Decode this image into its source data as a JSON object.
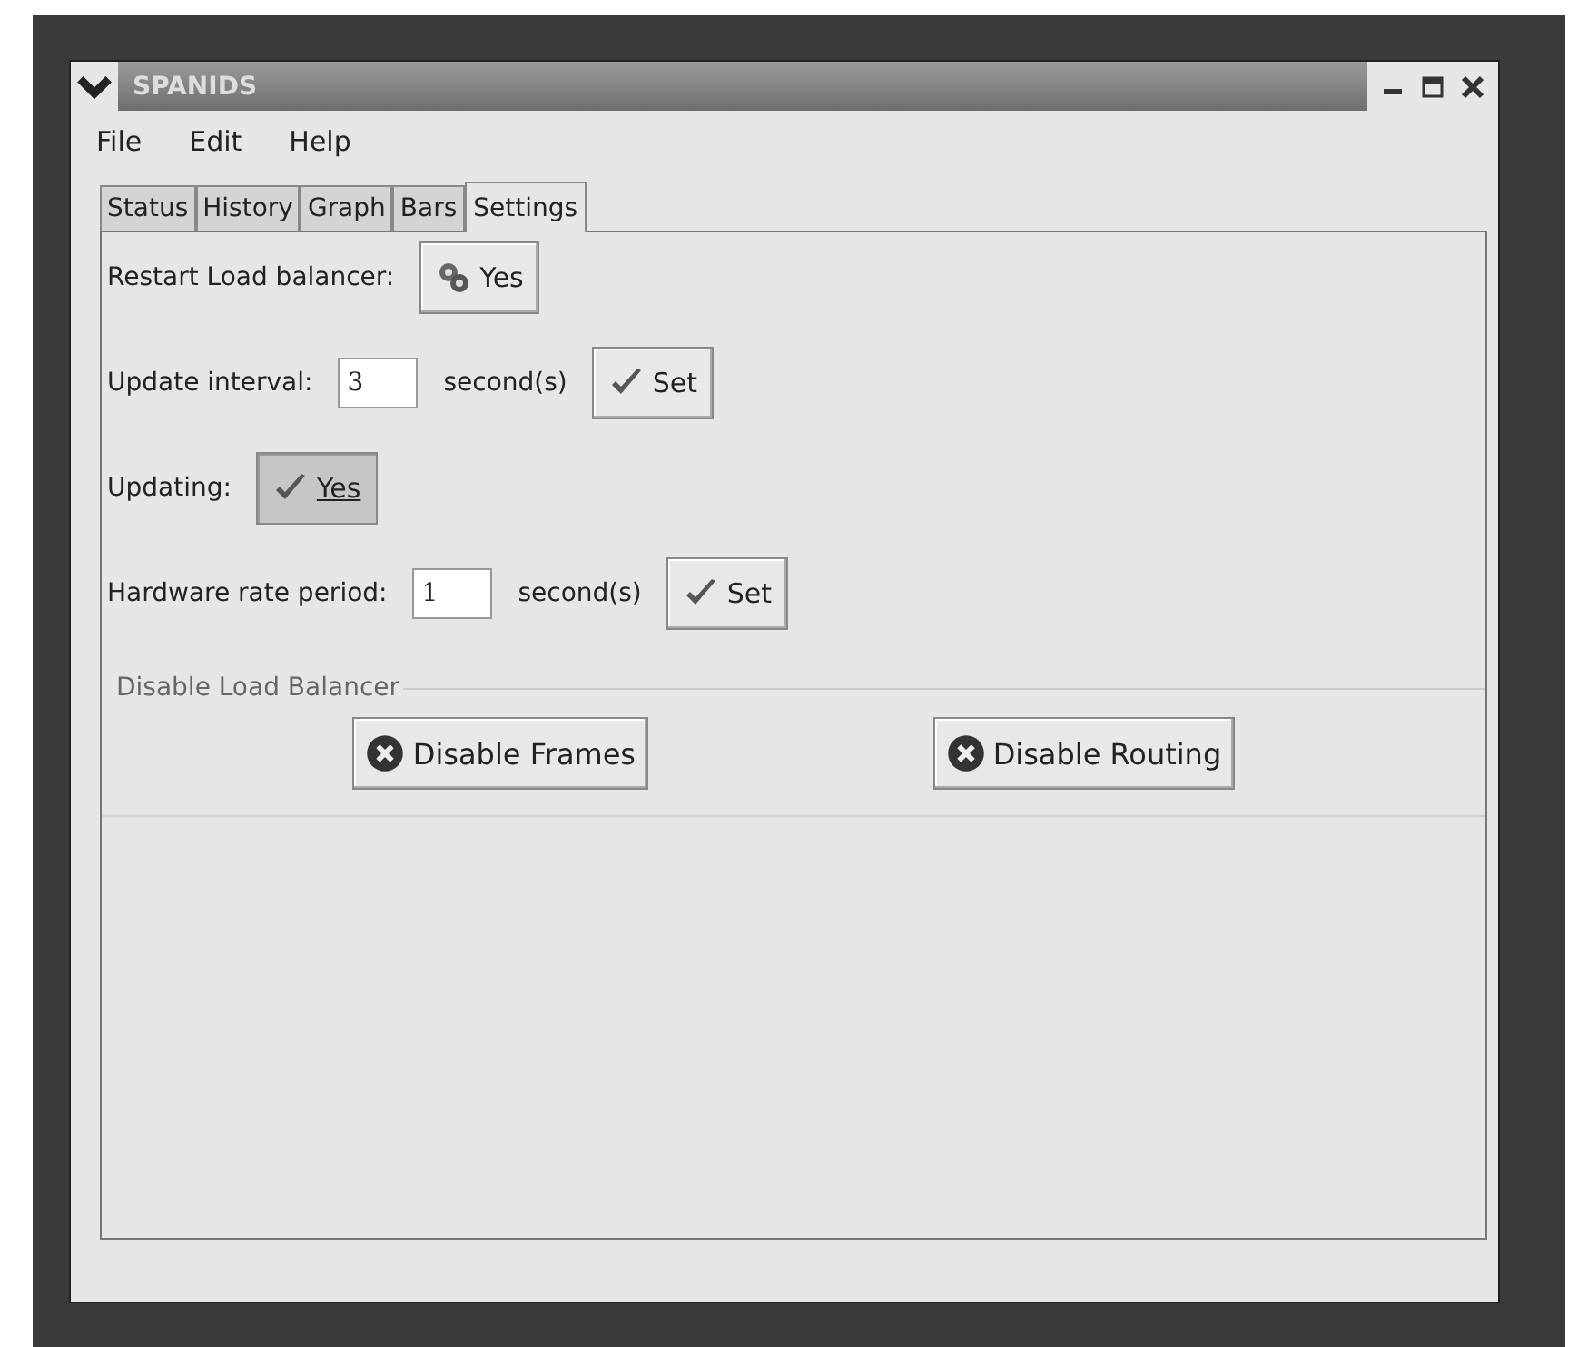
{
  "window": {
    "title": "SPANIDS"
  },
  "menu": [
    "File",
    "Edit",
    "Help"
  ],
  "tabs": [
    {
      "label": "Status",
      "selected": false
    },
    {
      "label": "History",
      "selected": false
    },
    {
      "label": "Graph",
      "selected": false
    },
    {
      "label": "Bars",
      "selected": false
    },
    {
      "label": "Settings",
      "selected": true
    }
  ],
  "settings": [
    {
      "kind": "button",
      "label": "Restart Load balancer:",
      "button": "Yes",
      "pressed": false
    },
    {
      "kind": "interval",
      "label": "Update interval:",
      "value": "3",
      "unit": "second(s)",
      "button": "Set",
      "pressed": false
    },
    {
      "kind": "toggle",
      "label": "Updating:",
      "button": "Yes",
      "pressed": true
    },
    {
      "kind": "interval",
      "label": "Hardware rate period:",
      "value": "1",
      "unit": "second(s)",
      "button": "Set",
      "pressed": false
    }
  ],
  "disable_group": {
    "title": "Disable Load Balancer",
    "buttons": [
      "Disable Frames",
      "Disable Routing"
    ]
  }
}
